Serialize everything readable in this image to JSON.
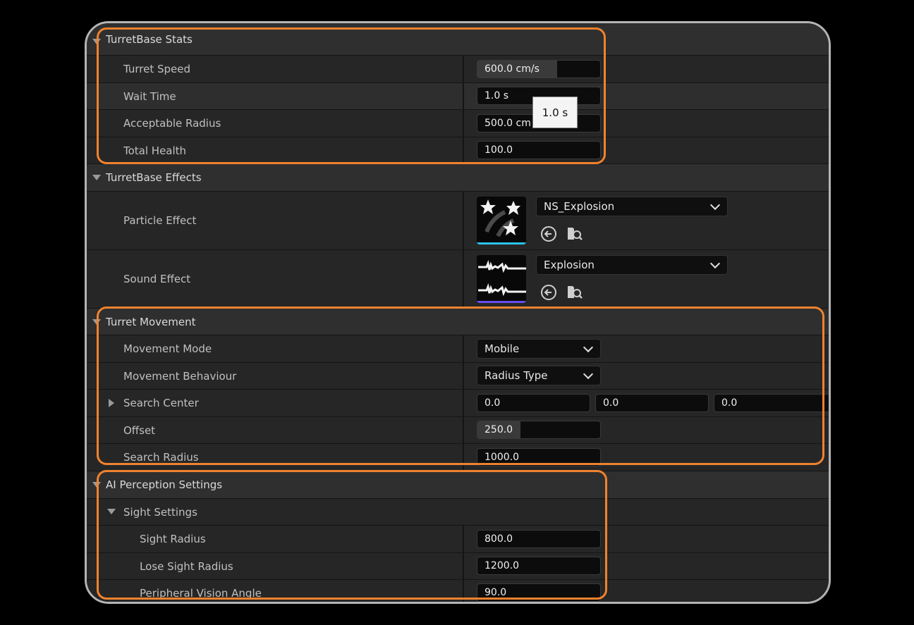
{
  "categories": {
    "stats": "TurretBase Stats",
    "effects": "TurretBase Effects",
    "movement": "Turret Movement",
    "perception": "AI Perception Settings",
    "sight": "Sight Settings"
  },
  "stats": {
    "turret_speed": {
      "label": "Turret Speed",
      "value": "600.0 cm/s",
      "slider_fraction": 0.65
    },
    "wait_time": {
      "label": "Wait Time",
      "value": "1.0 s"
    },
    "acceptable_radius": {
      "label": "Acceptable Radius",
      "value": "500.0 cm"
    },
    "total_health": {
      "label": "Total Health",
      "value": "100.0"
    }
  },
  "tooltip": "1.0 s",
  "effects": {
    "particle": {
      "label": "Particle Effect",
      "asset": "NS_Explosion"
    },
    "sound": {
      "label": "Sound Effect",
      "asset": "Explosion"
    }
  },
  "movement": {
    "mode": {
      "label": "Movement Mode",
      "value": "Mobile"
    },
    "behaviour": {
      "label": "Movement Behaviour",
      "value": "Radius Type"
    },
    "search_center": {
      "label": "Search Center",
      "x": "0.0",
      "y": "0.0",
      "z": "0.0"
    },
    "offset": {
      "label": "Offset",
      "value": "250.0",
      "slider_fraction": 0.35
    },
    "search_radius": {
      "label": "Search Radius",
      "value": "1000.0"
    }
  },
  "perception": {
    "sight_radius": {
      "label": "Sight Radius",
      "value": "800.0"
    },
    "lose_sight_radius": {
      "label": "Lose Sight Radius",
      "value": "1200.0"
    },
    "peripheral_vision_angle": {
      "label": "Peripheral Vision Angle",
      "value": "90.0"
    }
  },
  "icons": {
    "expand": "triangle-down-icon",
    "collapsed": "triangle-right-icon",
    "browse_use": "arrow-left-circle-icon",
    "browse_find": "folder-search-icon",
    "dropdown": "chevron-down-icon"
  },
  "colors": {
    "highlight_box": "#f0822e",
    "particle_bar": "#29c4e8",
    "sound_bar": "#6a4cf0"
  }
}
